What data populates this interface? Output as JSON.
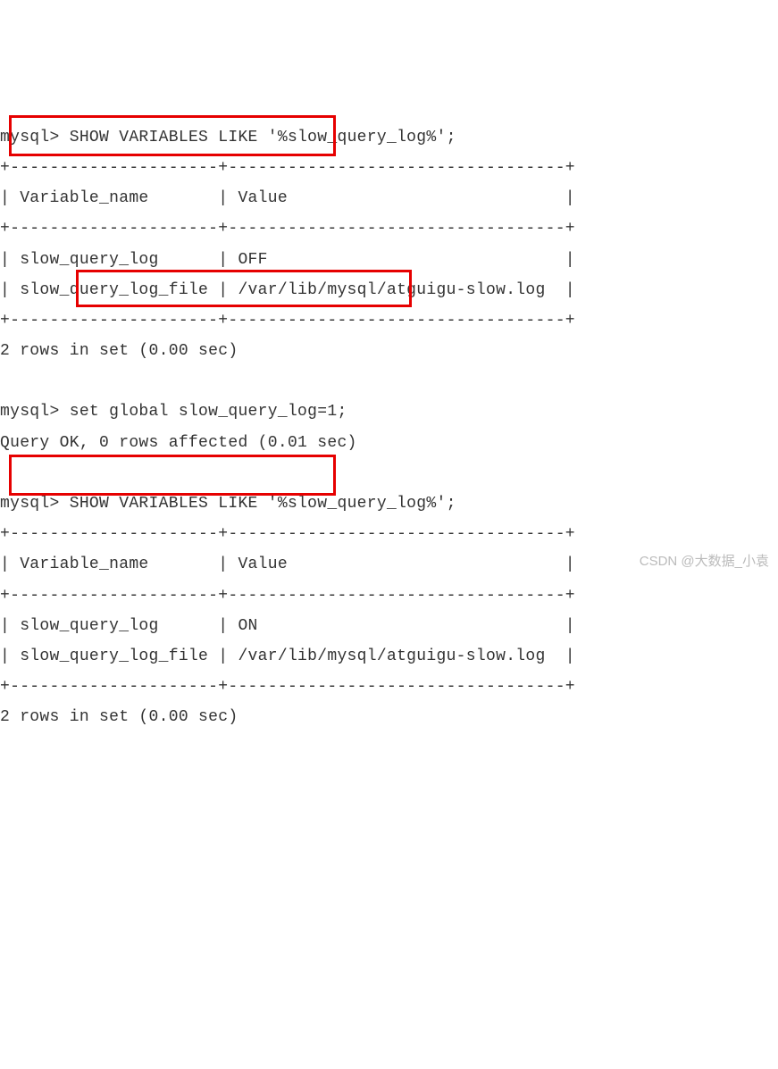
{
  "block1": {
    "prompt": "mysql> ",
    "command": "SHOW VARIABLES LIKE '%slow_query_log%';",
    "sep_top": "+---------------------+----------------------------------+",
    "header_row": "| Variable_name       | Value                            |",
    "sep_mid": "+---------------------+----------------------------------+",
    "row1": "| slow_query_log      | OFF                              |",
    "row2": "| slow_query_log_file | /var/lib/mysql/atguigu-slow.log  |",
    "sep_bot": "+---------------------+----------------------------------+",
    "footer": "2 rows in set (0.00 sec)"
  },
  "block2": {
    "prompt": "mysql> ",
    "command": "set global slow_query_log=1;",
    "result": "Query OK, 0 rows affected (0.01 sec)"
  },
  "block3": {
    "prompt": "mysql> ",
    "command": "SHOW VARIABLES LIKE '%slow_query_log%';",
    "sep_top": "+---------------------+----------------------------------+",
    "header_row": "| Variable_name       | Value                            |",
    "sep_mid": "+---------------------+----------------------------------+",
    "row1": "| slow_query_log      | ON                               |",
    "row2": "| slow_query_log_file | /var/lib/mysql/atguigu-slow.log  |",
    "sep_bot": "+---------------------+----------------------------------+",
    "footer": "2 rows in set (0.00 sec)"
  },
  "watermark": "CSDN @大数据_小袁"
}
